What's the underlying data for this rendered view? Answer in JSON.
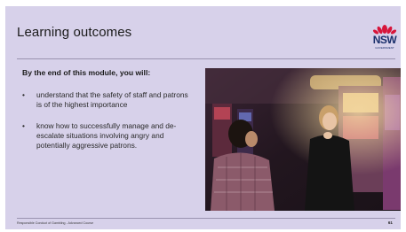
{
  "slide": {
    "title": "Learning outcomes",
    "lead": "By the end of this module, you will:",
    "bullets": [
      "understand that the safety of staff and patrons is of the highest importance",
      "know how to successfully manage and de-escalate situations involving angry and potentially aggressive patrons."
    ],
    "footer": "Responsible Conduct of Gambling - Advanced Course",
    "page_number": "61"
  },
  "logo": {
    "text": "NSW",
    "sub": "GOVERNMENT"
  },
  "colors": {
    "background": "#d7d1ea",
    "logo_red": "#d7153a",
    "logo_navy": "#1a2f6b"
  }
}
